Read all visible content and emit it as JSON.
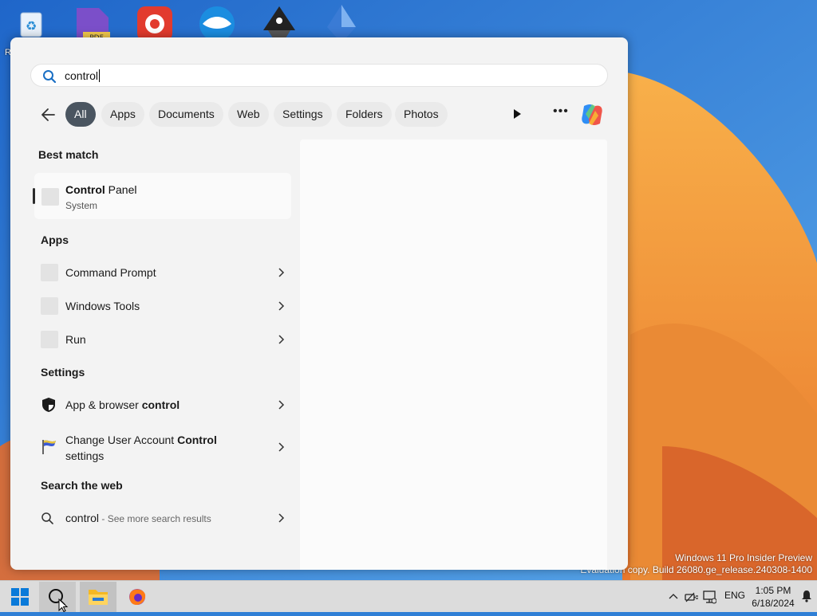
{
  "search": {
    "query": "control"
  },
  "filters": [
    {
      "label": "All",
      "active": true
    },
    {
      "label": "Apps"
    },
    {
      "label": "Documents"
    },
    {
      "label": "Web"
    },
    {
      "label": "Settings"
    },
    {
      "label": "Folders"
    },
    {
      "label": "Photos"
    }
  ],
  "sections": {
    "best_match": "Best match",
    "apps": "Apps",
    "settings": "Settings",
    "web": "Search the web"
  },
  "best_match": {
    "name_bold": "Control",
    "name_rest": " Panel",
    "subtitle": "System"
  },
  "apps": [
    {
      "label": "Command Prompt"
    },
    {
      "label": "Windows Tools"
    },
    {
      "label": "Run"
    }
  ],
  "settings": [
    {
      "pre": "App & browser ",
      "bold": "control",
      "post": "",
      "icon": "shield-icon"
    },
    {
      "pre": "Change User Account ",
      "bold": "Control",
      "post": "settings",
      "icon": "uac-flag-icon"
    }
  ],
  "web": {
    "query": "control",
    "hint": " - See more search results"
  },
  "watermark": {
    "line1": "Windows 11 Pro Insider Preview",
    "line2": "Evaluation copy. Build 26080.ge_release.240308-1400"
  },
  "tray": {
    "language": "ENG",
    "time": "1:05 PM",
    "date": "6/18/2024"
  },
  "colors": {
    "active_chip": "#4a5560",
    "panel_bg": "#f3f3f3",
    "taskbar_bg": "#dcdcdc"
  }
}
